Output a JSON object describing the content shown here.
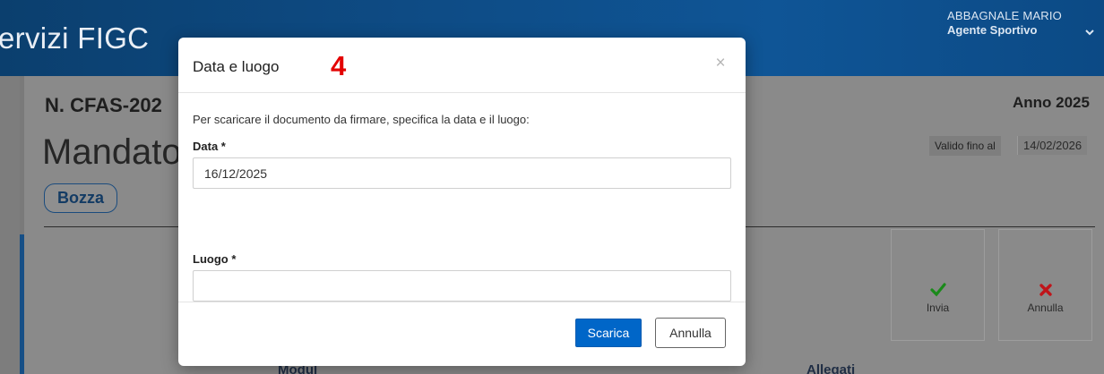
{
  "header": {
    "app_title": "ervizi FIGC",
    "user_name": "ABBAGNALE MARIO",
    "user_role": "Agente Sportivo"
  },
  "document": {
    "number": "N. CFAS-202",
    "title": "Mandato",
    "status": "Bozza",
    "year": "Anno 2025",
    "valid_label": "Valido fino al",
    "valid_value": "14/02/2026"
  },
  "actions": {
    "invia": "Invia",
    "annulla": "Annulla"
  },
  "bottom": {
    "left_text": "Modul",
    "right_text": "Allegati"
  },
  "modal": {
    "title": "Data e luogo",
    "step_number": "4",
    "close_symbol": "×",
    "intro": "Per scaricare il documento da firmare, specifica la data e il luogo:",
    "data_label": "Data *",
    "data_value": "16/12/2025",
    "luogo_label": "Luogo *",
    "luogo_value": "",
    "download_button": "Scarica",
    "cancel_button": "Annulla"
  },
  "colors": {
    "accent": "#0066c8",
    "topbar": "#0e4c86",
    "step_badge": "#e30000",
    "check": "#1a8a1a",
    "cross": "#c0141a"
  },
  "icons": {
    "chevron": "chevron-down-icon",
    "invia": "check-icon",
    "annulla": "x-icon",
    "close": "close-icon"
  }
}
